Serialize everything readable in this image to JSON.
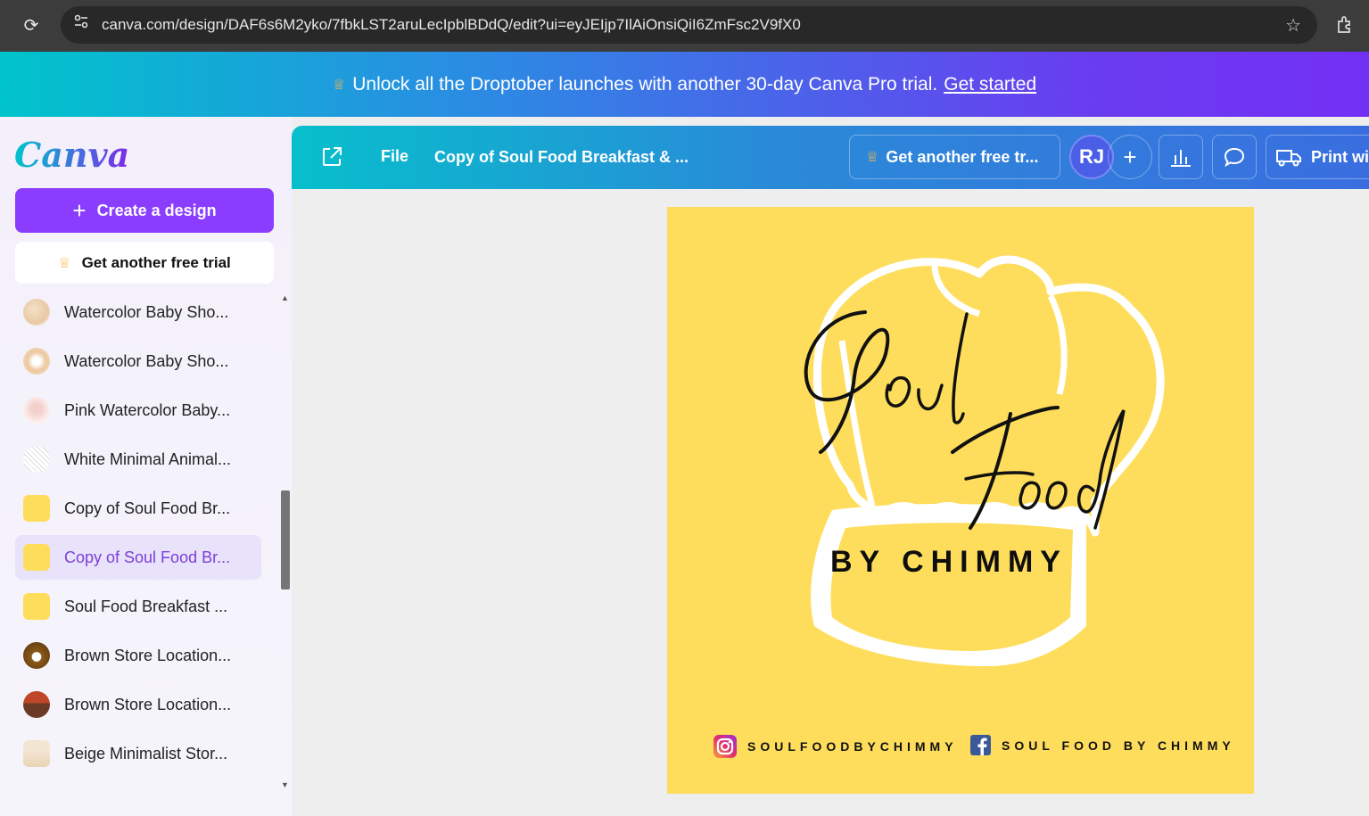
{
  "browser": {
    "url": "canva.com/design/DAF6s6M2yko/7fbkLST2aruLecIpblBDdQ/edit?ui=eyJEIjp7IlAiOnsiQiI6ZmFsc2V9fX0"
  },
  "promo": {
    "text": "Unlock all the Droptober launches with another 30-day Canva Pro trial.",
    "link": "Get started"
  },
  "sidebar": {
    "logo": "Canva",
    "create_label": "Create a design",
    "trial_label": "Get another free trial",
    "items": [
      {
        "label": "Watercolor Baby Sho..."
      },
      {
        "label": "Watercolor Baby Sho..."
      },
      {
        "label": "Pink Watercolor Baby..."
      },
      {
        "label": "White Minimal Animal..."
      },
      {
        "label": "Copy of Soul Food Br..."
      },
      {
        "label": "Copy of Soul Food Br..."
      },
      {
        "label": "Soul Food Breakfast ..."
      },
      {
        "label": "Brown Store Location..."
      },
      {
        "label": "Brown Store Location..."
      },
      {
        "label": "Beige Minimalist Stor..."
      }
    ]
  },
  "toolbar": {
    "file_label": "File",
    "title": "Copy of Soul Food Breakfast & ...",
    "more": "...",
    "trial_label": "Get another free tr...",
    "avatar_initials": "RJ",
    "print_label": "Print wi"
  },
  "design": {
    "script_word1": "Soul",
    "script_word2": "Food",
    "subtitle": "BY CHIMMY",
    "instagram": "SOULFOODBYCHIMMY",
    "facebook": "SOUL FOOD BY CHIMMY",
    "background_color": "#fedd5c"
  },
  "colors": {
    "accent": "#8b3dff",
    "active_item_bg": "#e8e2fa",
    "active_item_text": "#7d3fd8"
  }
}
